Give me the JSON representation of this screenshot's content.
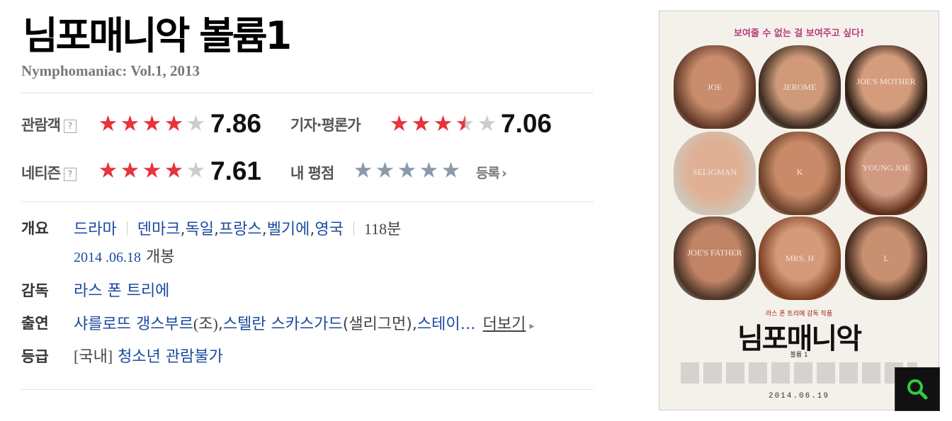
{
  "movie": {
    "title": "님포매니악 볼륨1",
    "original_title": "Nymphomaniac: Vol.1, 2013"
  },
  "ratings": {
    "audience": {
      "label": "관람객",
      "help": "?",
      "score": "7.86",
      "stars_filled": 4.0
    },
    "critics": {
      "label": "기자·평론가",
      "score": "7.06",
      "stars_filled": 3.5
    },
    "netizen": {
      "label": "네티즌",
      "help": "?",
      "score": "7.61",
      "stars_filled": 4.0
    },
    "mine": {
      "label": "내 평점",
      "stars_filled": 0,
      "register_label": "등록",
      "register_arrow": "›"
    }
  },
  "info": {
    "overview": {
      "label": "개요",
      "genre": "드라마",
      "countries": [
        "덴마크",
        "독일",
        "프랑스",
        "벨기에",
        "영국"
      ],
      "runtime": "118분",
      "release_date": "2014 .06.18",
      "release_suffix": "개봉"
    },
    "director": {
      "label": "감독",
      "name": "라스 폰 트리에"
    },
    "cast": {
      "label": "출연",
      "actor1": "샤를로뜨 갱스부르",
      "role1": "(조)",
      "comma1": ",",
      "actor2": "스텔란 스카스가드",
      "role2": "(샐리그먼)",
      "comma2": ",",
      "actor3": "스테이…",
      "more_label": "더보기",
      "more_arrow": "▸"
    },
    "rating": {
      "label": "등급",
      "region": "[국내]",
      "value": "청소년 관람불가"
    }
  },
  "poster": {
    "tagline": "보여줄 수 없는 걸 보여주고 싶다!",
    "kicker": "라스 폰 트리에 감독 작품",
    "title": "님포매니악",
    "subtitle": "볼륨 1",
    "names": [
      "JOE",
      "JEROME",
      "JOE'S MOTHER",
      "SELIGMAN",
      "K",
      "YOUNG JOE",
      "JOE'S FATHER",
      "MRS. H",
      "L"
    ],
    "date": "2014.06.19",
    "zoom_icon": "magnifier-icon"
  },
  "colors": {
    "star_red": "#e8323c",
    "star_gray": "#cccccc",
    "star_blue_gray": "#8a9aaa",
    "link": "#1a4a9e",
    "zoom_green": "#2ecc40"
  }
}
